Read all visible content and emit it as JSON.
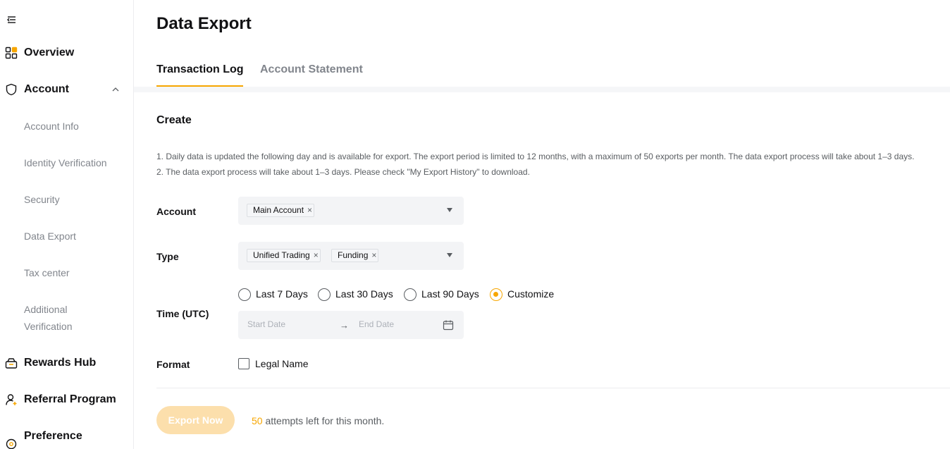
{
  "sidebar": {
    "items": [
      {
        "label": "Overview",
        "icon": "grid-icon"
      },
      {
        "label": "Account",
        "icon": "shield-icon",
        "expanded": true,
        "children": [
          {
            "label": "Account Info"
          },
          {
            "label": "Identity Verification"
          },
          {
            "label": "Security"
          },
          {
            "label": "Data Export"
          },
          {
            "label": "Tax center"
          },
          {
            "label": "Additional",
            "label2": "Verification"
          }
        ]
      },
      {
        "label": "Rewards Hub",
        "icon": "gift-box-icon"
      },
      {
        "label": "Referral Program",
        "icon": "user-plus-icon"
      },
      {
        "label": "Preference",
        "icon": "settings-icon"
      }
    ]
  },
  "page": {
    "title": "Data Export",
    "tabs": [
      {
        "label": "Transaction Log",
        "active": true
      },
      {
        "label": "Account Statement",
        "active": false
      }
    ]
  },
  "form": {
    "section_title": "Create",
    "notes": [
      "1.  Daily data is updated the following day and is available for export. The export period is limited to 12 months, with a maximum of 50 exports per month. The data export process will take about 1–3 days.",
      "2.  The data export process will take about 1–3 days. Please check \"My Export History\" to download."
    ],
    "account": {
      "label": "Account",
      "tags": [
        "Main Account"
      ]
    },
    "type": {
      "label": "Type",
      "tags": [
        "Unified Trading",
        "Funding"
      ]
    },
    "time": {
      "label": "Time (UTC)",
      "options": [
        "Last 7 Days",
        "Last 30 Days",
        "Last 90 Days",
        "Customize"
      ],
      "selected": "Customize",
      "start_placeholder": "Start Date",
      "end_placeholder": "End Date",
      "arrow": "→"
    },
    "format": {
      "label": "Format",
      "checkbox_label": "Legal Name",
      "checked": false
    },
    "export_button": "Export Now",
    "attempts_count": "50",
    "attempts_text": " attempts left for this month."
  },
  "colors": {
    "accent": "#f7a600",
    "button_disabled": "#fcdfac",
    "muted_text": "#81858c"
  }
}
